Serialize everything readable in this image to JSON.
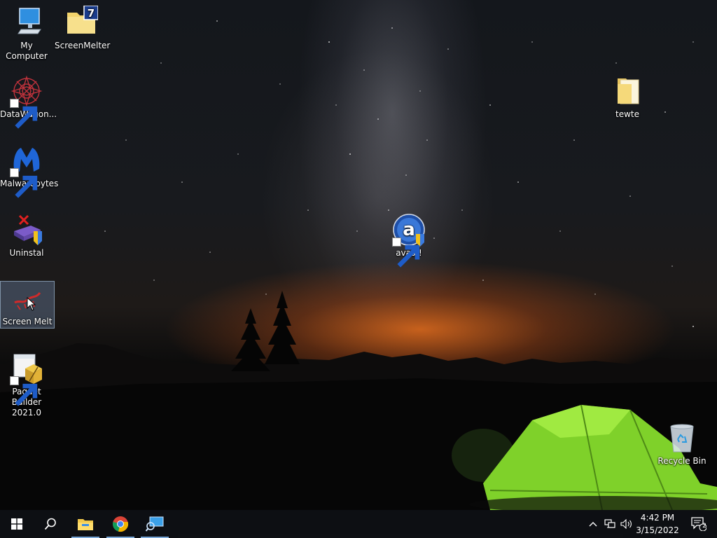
{
  "desktop": {
    "icons": [
      {
        "label": "My Computer",
        "icon": "computer-icon"
      },
      {
        "label": "ScreenMelter",
        "icon": "folder-icon"
      },
      {
        "label": "DataWagon...",
        "icon": "datawagon-icon"
      },
      {
        "label": "Malwarebytes",
        "icon": "malwarebytes-icon"
      },
      {
        "label": "Uninstal",
        "icon": "uninstall-icon"
      },
      {
        "label": "Screen Melt",
        "icon": "screen-melt-icon"
      },
      {
        "label": "Paquet Builder 2021.0",
        "icon": "package-icon"
      },
      {
        "label": "avast!",
        "icon": "avast-icon"
      },
      {
        "label": "tewte",
        "icon": "folder-icon"
      },
      {
        "label": "Recycle Bin",
        "icon": "recycle-bin-icon"
      }
    ],
    "selected_icon": "Screen Melt"
  },
  "taskbar": {
    "start": "windows-start-icon",
    "search": "search-icon",
    "pinned": [
      "file-explorer-icon",
      "chrome-icon",
      "remote-desktop-icon"
    ],
    "tray": {
      "chevron": "chevron-up-icon",
      "network": "network-icon",
      "volume": "volume-icon"
    },
    "clock": {
      "time": "4:42 PM",
      "date": "3/15/2022"
    },
    "notifications": {
      "count": "2"
    }
  },
  "colors": {
    "taskbar": "#0e1014",
    "accent_underline": "#7aa8d8",
    "tent_green": "#8ee02a"
  }
}
